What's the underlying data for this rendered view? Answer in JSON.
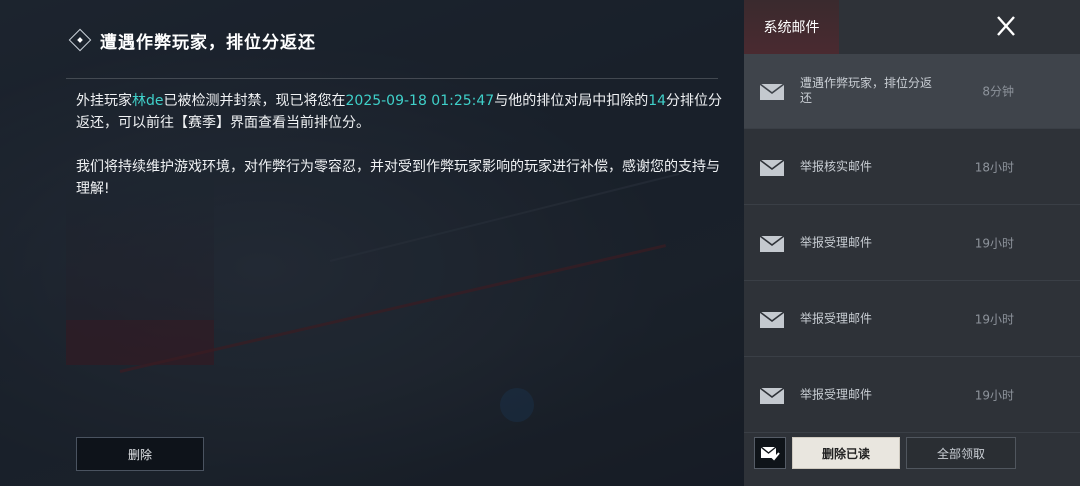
{
  "mail": {
    "title": "遭遇作弊玩家，排位分返还",
    "body": {
      "p1_a": "外挂玩家",
      "p1_player": "林de",
      "p1_b": "已被检测并封禁，现已将您在",
      "p1_datetime": "2025-09-18 01:25:47",
      "p1_c": "与他的排位对局中扣除的",
      "p1_points": "14",
      "p1_d": "分排位分返还，可以前往【赛季】界面查看当前排位分。",
      "p2": "我们将持续维护游戏环境，对作弊行为零容忍，并对受到作弊玩家影响的玩家进行补偿，感谢您的支持与理解!"
    },
    "delete_label": "删除"
  },
  "sidebar": {
    "tab_label": "系统邮件",
    "items": [
      {
        "title": "遭遇作弊玩家，排位分返还",
        "time": "8分钟",
        "selected": true
      },
      {
        "title": "举报核实邮件",
        "time": "18小时",
        "selected": false
      },
      {
        "title": "举报受理邮件",
        "time": "19小时",
        "selected": false
      },
      {
        "title": "举报受理邮件",
        "time": "19小时",
        "selected": false
      },
      {
        "title": "举报受理邮件",
        "time": "19小时",
        "selected": false
      }
    ],
    "delete_read_label": "删除已读",
    "claim_all_label": "全部领取"
  },
  "icons": {
    "close": "close-icon",
    "envelope": "envelope-icon",
    "title_marker": "diamond-icon",
    "bulk_select": "envelope-check-icon"
  },
  "colors": {
    "highlight": "#3fd0c9",
    "active_tab_underline": "#c23b3b",
    "primary_button": "#e9e6df"
  }
}
